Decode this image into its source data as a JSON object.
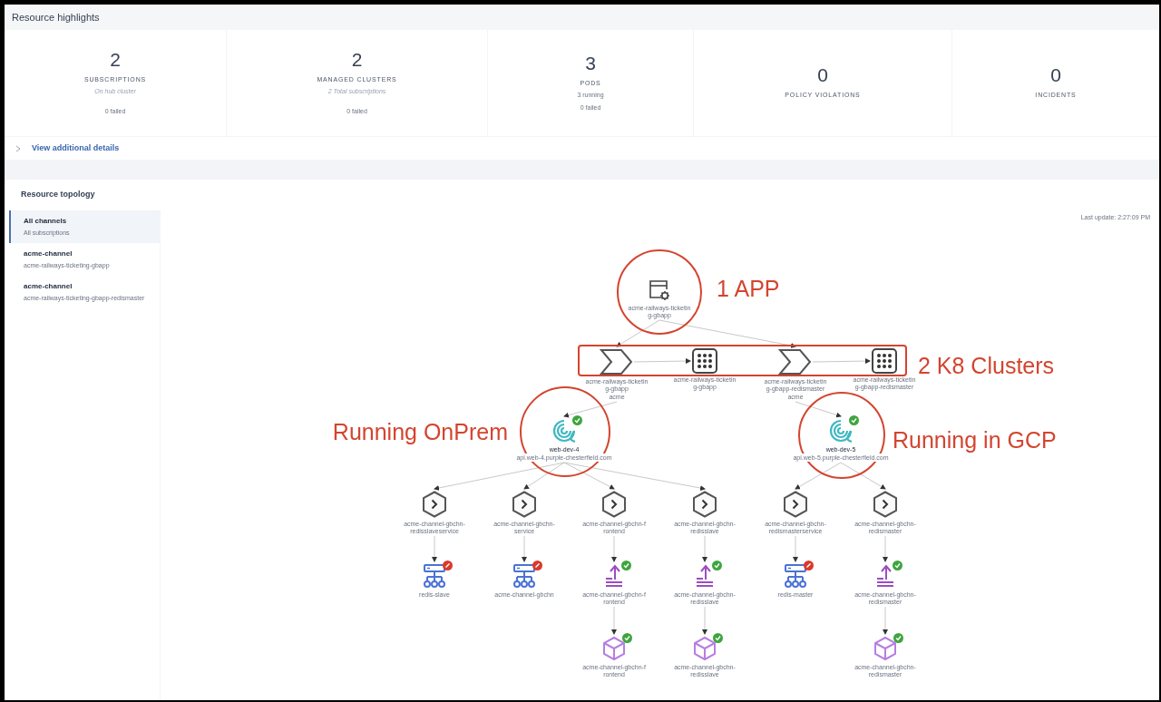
{
  "highlights": {
    "title": "Resource highlights",
    "stats": [
      {
        "value": "2",
        "label": "SUBSCRIPTIONS",
        "notes": [
          {
            "kind": "subtitle",
            "text": "On hub cluster"
          },
          {
            "kind": "detail",
            "text": "0 failed"
          }
        ]
      },
      {
        "value": "2",
        "label": "MANAGED CLUSTERS",
        "notes": [
          {
            "kind": "subtitle",
            "text": "2 Total subscriptions"
          },
          {
            "kind": "detail",
            "text": "0 failed"
          }
        ]
      },
      {
        "value": "3",
        "label": "PODS",
        "notes": [
          {
            "kind": "detail",
            "text": "3 running"
          },
          {
            "kind": "detail",
            "text": "0 failed"
          }
        ]
      },
      {
        "value": "0",
        "label": "POLICY VIOLATIONS"
      },
      {
        "value": "0",
        "label": "INCIDENTS"
      }
    ],
    "details_toggle": {
      "label": "View additional details",
      "expanded": false
    }
  },
  "topology": {
    "title": "Resource topology",
    "channels": [
      {
        "name": "All channels",
        "subtitle": "All subscriptions",
        "selected": true
      },
      {
        "name": "acme-channel",
        "subtitle": "acme-railways-ticketing-gbapp",
        "selected": false
      },
      {
        "name": "acme-channel",
        "subtitle": "acme-railways-ticketing-gbapp-redismaster",
        "selected": false
      }
    ],
    "last_update": "Last update: 2:27:09 PM",
    "nodes": [
      {
        "kind": "app",
        "label": "acme-railways-ticketing-gbapp"
      },
      {
        "kind": "subscription",
        "label": "acme-railways-ticketing-gbapp",
        "sublabel": "acme"
      },
      {
        "kind": "rule",
        "label": "acme-railways-ticketing-gbapp"
      },
      {
        "kind": "subscription",
        "label": "acme-railways-ticketing-gbapp-redismaster",
        "sublabel": "acme"
      },
      {
        "kind": "rule",
        "label": "acme-railways-ticketing-gbapp-redismaster"
      },
      {
        "kind": "cluster",
        "label": "web-dev-4",
        "sublabel": "api.web-4.purple-chesterfield.com",
        "healthy": true
      },
      {
        "kind": "cluster",
        "label": "web-dev-5",
        "sublabel": "api.web-5.purple-chesterfield.com",
        "healthy": true
      },
      {
        "kind": "service",
        "label": "acme-channel-gbchn-redisslaveservice"
      },
      {
        "kind": "service",
        "label": "acme-channel-gbchn-service"
      },
      {
        "kind": "service",
        "label": "acme-channel-gbchn-frontend"
      },
      {
        "kind": "service",
        "label": "acme-channel-gbchn-redisslave"
      },
      {
        "kind": "service",
        "label": "acme-channel-gbchn-redismasterservice"
      },
      {
        "kind": "service",
        "label": "acme-channel-gbchn-redismaster"
      },
      {
        "kind": "network",
        "label": "redis-slave",
        "healthy": false
      },
      {
        "kind": "network",
        "label": "acme-channel-gbchn",
        "healthy": false
      },
      {
        "kind": "deployment",
        "label": "acme-channel-gbchn-frontend",
        "healthy": true
      },
      {
        "kind": "deployment",
        "label": "acme-channel-gbchn-redisslave",
        "healthy": true
      },
      {
        "kind": "network",
        "label": "redis-master",
        "healthy": false
      },
      {
        "kind": "deployment",
        "label": "acme-channel-gbchn-redismaster",
        "healthy": true
      },
      {
        "kind": "pod",
        "label": "acme-channel-gbchn-frontend",
        "healthy": true
      },
      {
        "kind": "pod",
        "label": "acme-channel-gbchn-redisslave",
        "healthy": true
      },
      {
        "kind": "pod",
        "label": "acme-channel-gbchn-redismaster",
        "healthy": true
      }
    ],
    "callouts": [
      {
        "text": "1 APP"
      },
      {
        "text": "2 K8 Clusters"
      },
      {
        "text": "Running OnPrem"
      },
      {
        "text": "Running in GCP"
      }
    ]
  }
}
